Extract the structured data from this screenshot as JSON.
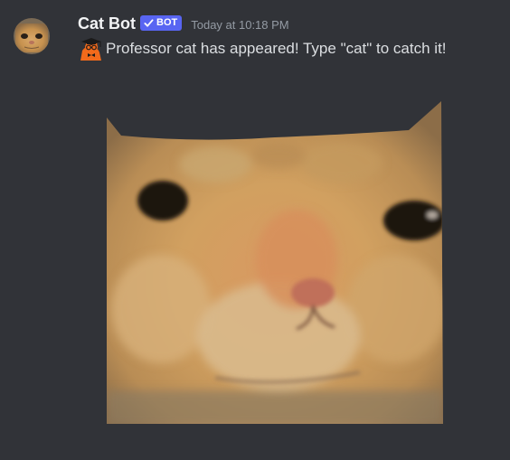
{
  "message": {
    "author": {
      "name": "Cat Bot",
      "bot_tag": "BOT",
      "avatar_icon": "cat-face-avatar"
    },
    "timestamp": "Today at 10:18 PM",
    "emoji_icon": "professor-cat-emoji",
    "text": "Professor cat has appeared! Type \"cat\" to catch it!",
    "attachment": {
      "icon": "cat-face-image"
    }
  },
  "colors": {
    "background": "#313338",
    "username": "#f2f3f5",
    "bot_tag": "#5865f2",
    "timestamp": "#949ba4",
    "text": "#dbdee1"
  }
}
